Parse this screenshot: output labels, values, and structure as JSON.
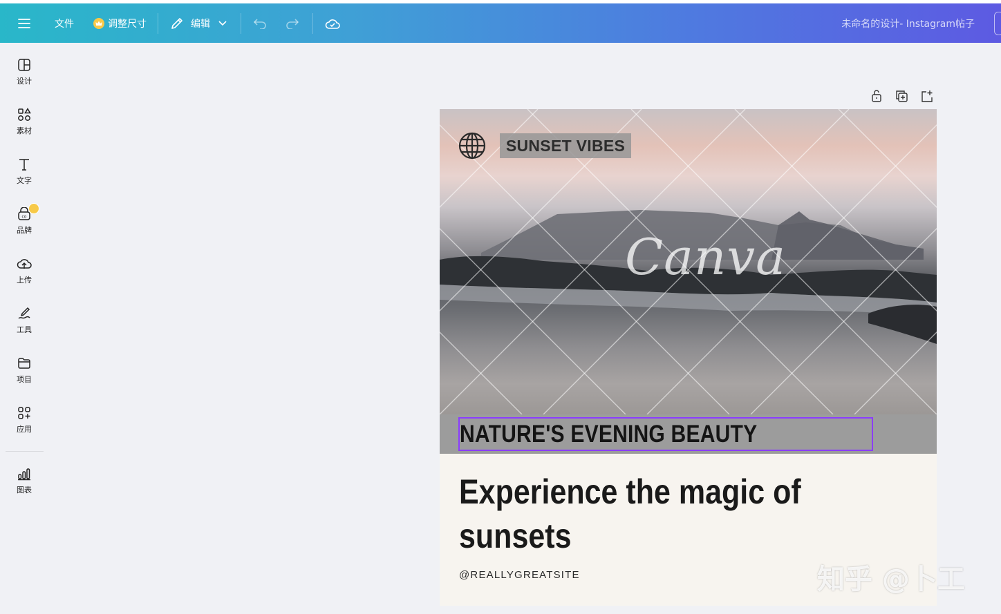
{
  "topbar": {
    "menu_icon": "hamburger-icon",
    "file": "文件",
    "resize": "调整尺寸",
    "edit": "编辑",
    "undo_icon": "undo-icon",
    "redo_icon": "redo-icon",
    "save_icon": "cloud-check-icon",
    "doc_title": "未命名的设计- Instagram帖子"
  },
  "sidebar": {
    "items": [
      {
        "label": "设计",
        "icon": "layout-icon"
      },
      {
        "label": "素材",
        "icon": "shapes-icon"
      },
      {
        "label": "文字",
        "icon": "text-icon"
      },
      {
        "label": "品牌",
        "icon": "brand-icon"
      },
      {
        "label": "上传",
        "icon": "upload-cloud-icon"
      },
      {
        "label": "工具",
        "icon": "draw-icon"
      },
      {
        "label": "项目",
        "icon": "folder-icon"
      },
      {
        "label": "应用",
        "icon": "apps-icon"
      },
      {
        "label": "图表",
        "icon": "chart-icon"
      }
    ]
  },
  "page_tools": [
    "lock-icon",
    "duplicate-icon",
    "add-page-icon"
  ],
  "design": {
    "tag": "SUNSET VIBES",
    "watermark": "Canva",
    "headline": "NATURE'S EVENING BEAUTY",
    "body": "Experience the magic of sunsets",
    "site": "@REALLYGREATSITE"
  },
  "watermark_zhihu": "知乎 @卜工",
  "colors": {
    "topbar_start": "#29b7c9",
    "topbar_end": "#5d5ae2",
    "selection": "#8b3dff",
    "canvas_bg": "#f7f4ef",
    "band": "#9c9c9c"
  }
}
